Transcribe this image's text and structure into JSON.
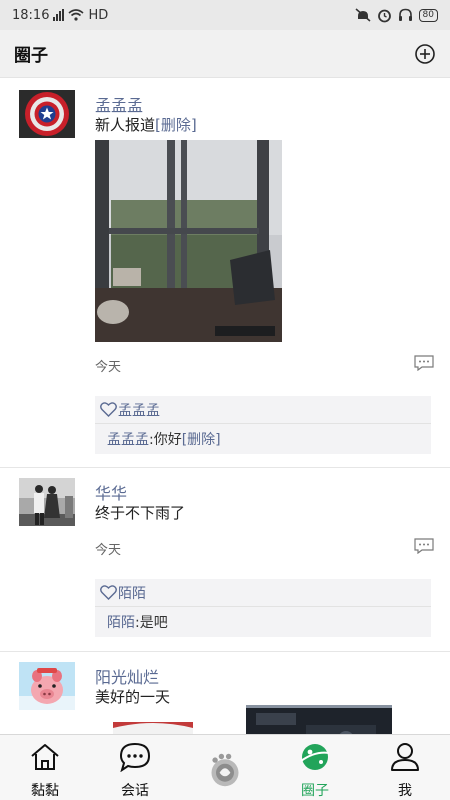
{
  "status_bar": {
    "time": "18:16",
    "network": "HD",
    "battery": "80"
  },
  "header": {
    "title": "圈子",
    "add_icon": "add-circle-icon"
  },
  "posts": [
    {
      "author": "孟孟孟",
      "text": "新人报道",
      "delete_label": "[删除]",
      "time": "今天",
      "likes": "孟孟孟",
      "comments": [
        {
          "name": "孟孟孟",
          "text": ":你好",
          "delete_label": "[删除]"
        }
      ]
    },
    {
      "author": "华华",
      "text": "终于不下雨了",
      "time": "今天",
      "likes": "陌陌",
      "comments": [
        {
          "name": "陌陌",
          "text": ":是吧"
        }
      ]
    },
    {
      "author": "阳光灿烂",
      "text": "美好的一天"
    }
  ],
  "tabs": [
    {
      "label": "黏黏",
      "icon": "home-icon",
      "active": false
    },
    {
      "label": "会话",
      "icon": "chat-bubble-icon",
      "active": false
    },
    {
      "label": "",
      "icon": "center-logo-icon",
      "active": false
    },
    {
      "label": "圈子",
      "icon": "planet-icon",
      "active": true
    },
    {
      "label": "我",
      "icon": "person-icon",
      "active": false
    }
  ],
  "colors": {
    "accent": "#22a45a",
    "link": "#5a6a92",
    "header_bg": "#f1f1f1"
  }
}
